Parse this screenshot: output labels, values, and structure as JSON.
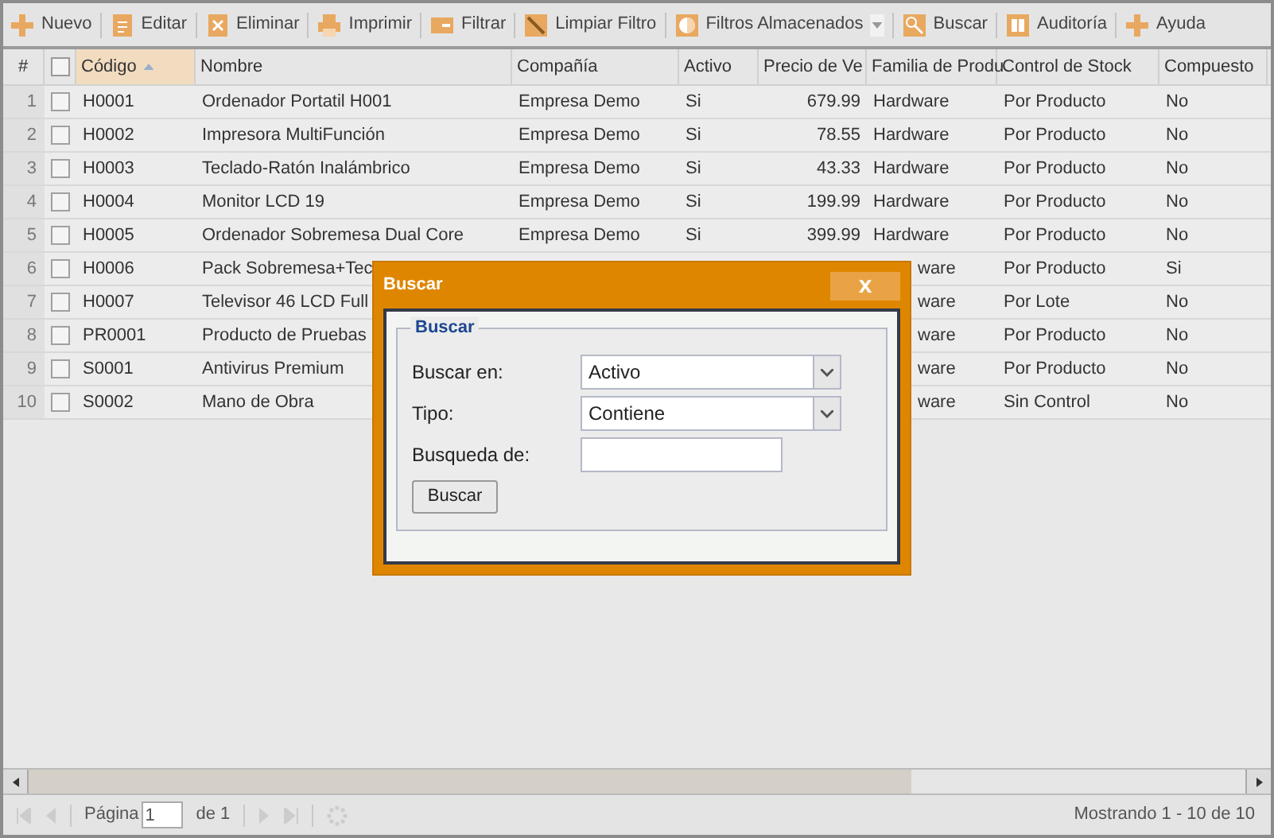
{
  "toolbar": [
    {
      "label": "Nuevo"
    },
    {
      "label": "Editar"
    },
    {
      "label": "Eliminar"
    },
    {
      "label": "Imprimir"
    },
    {
      "label": "Filtrar"
    },
    {
      "label": "Limpiar Filtro"
    },
    {
      "label": "Filtros Almacenados",
      "dropdown": true
    },
    {
      "label": "Buscar"
    },
    {
      "label": "Auditoría"
    },
    {
      "label": "Ayuda"
    }
  ],
  "table": {
    "number_header": "#",
    "all_checked": false,
    "columns": [
      {
        "label": "Código",
        "sorted": true
      },
      {
        "label": "Nombre",
        "sorted": false
      },
      {
        "label": "Compañía",
        "sorted": false
      },
      {
        "label": "Activo",
        "sorted": false
      },
      {
        "label": "Precio de Ve",
        "sorted": false
      },
      {
        "label": "Familia de Produ",
        "sorted": false
      },
      {
        "label": "Control de Stock",
        "sorted": false
      },
      {
        "label": "Compuesto",
        "sorted": false
      }
    ],
    "rows": [
      {
        "num": "1",
        "checked": false,
        "covered": false,
        "cells": [
          "H0001",
          "Ordenador Portatil H001",
          "Empresa Demo",
          "Si",
          "679.99",
          "Hardware",
          "Por Producto",
          "No"
        ]
      },
      {
        "num": "2",
        "checked": false,
        "covered": false,
        "cells": [
          "H0002",
          "Impresora MultiFunción",
          "Empresa Demo",
          "Si",
          "78.55",
          "Hardware",
          "Por Producto",
          "No"
        ]
      },
      {
        "num": "3",
        "checked": false,
        "covered": false,
        "cells": [
          "H0003",
          "Teclado-Ratón Inalámbrico",
          "Empresa Demo",
          "Si",
          "43.33",
          "Hardware",
          "Por Producto",
          "No"
        ]
      },
      {
        "num": "4",
        "checked": false,
        "covered": false,
        "cells": [
          "H0004",
          "Monitor LCD 19",
          "Empresa Demo",
          "Si",
          "199.99",
          "Hardware",
          "Por Producto",
          "No"
        ]
      },
      {
        "num": "5",
        "checked": false,
        "covered": false,
        "cells": [
          "H0005",
          "Ordenador Sobremesa Dual Core",
          "Empresa Demo",
          "Si",
          "399.99",
          "Hardware",
          "Por Producto",
          "No"
        ]
      },
      {
        "num": "6",
        "checked": false,
        "covered": true,
        "cells": [
          "H0006",
          "Pack Sobremesa+Tec",
          "ware",
          "Por Producto",
          "Si"
        ]
      },
      {
        "num": "7",
        "checked": false,
        "covered": true,
        "cells": [
          "H0007",
          "Televisor 46 LCD Full",
          "ware",
          "Por Lote",
          "No"
        ]
      },
      {
        "num": "8",
        "checked": false,
        "covered": true,
        "cells": [
          "PR0001",
          "Producto de Pruebas",
          "ware",
          "Por Producto",
          "No"
        ]
      },
      {
        "num": "9",
        "checked": false,
        "covered": true,
        "cells": [
          "S0001",
          "Antivirus Premium",
          "ware",
          "Por Producto",
          "No"
        ]
      },
      {
        "num": "10",
        "checked": false,
        "covered": true,
        "cells": [
          "S0002",
          "Mano de Obra",
          "ware",
          "Sin Control",
          "No"
        ]
      }
    ]
  },
  "dialog": {
    "title": "Buscar",
    "close": "x",
    "legend": "Buscar",
    "fields": [
      {
        "kind": "select",
        "label": "Buscar en:",
        "value": "Activo"
      },
      {
        "kind": "select",
        "label": "Tipo:",
        "value": "Contiene"
      },
      {
        "kind": "text",
        "label": "Busqueda de:"
      }
    ],
    "button": "Buscar"
  },
  "paging": {
    "page_label": "Página",
    "page": "1",
    "of": "de 1",
    "status": "Mostrando 1 - 10 de 10"
  }
}
